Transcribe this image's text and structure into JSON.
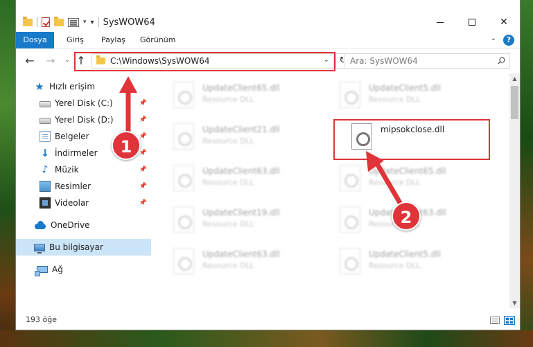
{
  "window": {
    "title": "SysWOW64"
  },
  "ribbon": {
    "tabs": [
      {
        "label": "Dosya"
      },
      {
        "label": "Giriş"
      },
      {
        "label": "Paylaş"
      },
      {
        "label": "Görünüm"
      }
    ]
  },
  "navbar": {
    "address": "C:\\Windows\\SysWOW64",
    "search_placeholder": "Ara: SysWOW64"
  },
  "sidebar": {
    "items": [
      {
        "label": "Hızlı erişim",
        "icon": "star-icon"
      },
      {
        "label": "Yerel Disk (C:)",
        "icon": "disk-icon"
      },
      {
        "label": "Yerel Disk (D:)",
        "icon": "disk-icon"
      },
      {
        "label": "Belgeler",
        "icon": "documents-icon"
      },
      {
        "label": "İndirmeler",
        "icon": "downloads-icon"
      },
      {
        "label": "Müzik",
        "icon": "music-icon"
      },
      {
        "label": "Resimler",
        "icon": "pictures-icon"
      },
      {
        "label": "Videolar",
        "icon": "videos-icon"
      },
      {
        "label": "OneDrive",
        "icon": "cloud-icon"
      },
      {
        "label": "Bu bilgisayar",
        "icon": "computer-icon"
      },
      {
        "label": "Ağ",
        "icon": "network-icon"
      }
    ]
  },
  "files": [
    {
      "name": "UpdateClient65.dll",
      "type": "Resource DLL"
    },
    {
      "name": "UpdateClient5.dll",
      "type": "Resource DLL"
    },
    {
      "name": "UpdateClient21.dll",
      "type": "Resource DLL"
    },
    {
      "name": "mipsokclose.dll",
      "type": ""
    },
    {
      "name": "UpdateClient63.dll",
      "type": "Resource DLL"
    },
    {
      "name": "UpdateClient65.dll",
      "type": "Resource DLL"
    },
    {
      "name": "UpdateClient19.dll",
      "type": "Resource DLL"
    },
    {
      "name": "UpdateClient63.dll",
      "type": "Resource DLL"
    },
    {
      "name": "UpdateClient63.dll",
      "type": "Resource DLL"
    },
    {
      "name": "UpdateClient5.dll",
      "type": "Resource DLL"
    }
  ],
  "status": {
    "item_count": "193 öğe"
  },
  "annotations": {
    "step1": "1",
    "step2": "2",
    "color": "#e0343a"
  },
  "colors": {
    "accent": "#1979ca"
  }
}
